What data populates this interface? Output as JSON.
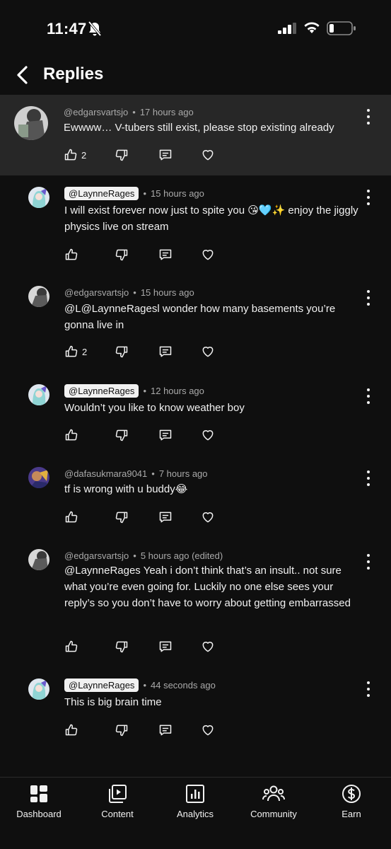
{
  "status": {
    "time": "11:47"
  },
  "header": {
    "title": "Replies"
  },
  "main_comment": {
    "handle": "@edgarsvartsjo",
    "time": "17 hours ago",
    "text": "Ewwww… V-tubers still exist, please stop existing already",
    "likes": "2"
  },
  "replies": [
    {
      "handle": "@LaynneRages",
      "time": "15 hours ago",
      "text": "I will exist forever now just to spite you 😘🩵✨ enjoy the jiggly physics live on stream",
      "likes": ""
    },
    {
      "handle": "@edgarsvartsjo",
      "time": "15 hours ago",
      "text": "@L@LaynneRagesl wonder how many basements you’re gonna live in",
      "likes": "2"
    },
    {
      "handle": "@LaynneRages",
      "time": "12 hours ago",
      "text": "Wouldn’t you like to know weather boy",
      "likes": ""
    },
    {
      "handle": "@dafasukmara9041",
      "time": "7 hours ago",
      "text": "tf is wrong with u buddy😂",
      "likes": ""
    },
    {
      "handle": "@edgarsvartsjo",
      "time": "5 hours ago (edited)",
      "text": "@LaynneRages Yeah i don’t think that’s an insult.. not sure what you’re even going for. Luckily no one else sees your reply’s so you don’t have to worry about getting embarrassed",
      "likes": ""
    },
    {
      "handle": "@LaynneRages",
      "time": "44 seconds ago",
      "text": "This is big brain time",
      "likes": ""
    }
  ],
  "separator": "•",
  "nav": [
    {
      "label": "Dashboard",
      "icon": "dashboard-icon"
    },
    {
      "label": "Content",
      "icon": "content-icon"
    },
    {
      "label": "Analytics",
      "icon": "analytics-icon"
    },
    {
      "label": "Community",
      "icon": "community-icon"
    },
    {
      "label": "Earn",
      "icon": "earn-icon"
    }
  ],
  "colors": {
    "background": "#0f0f0f",
    "highlight": "#272727",
    "text": "#f1f1f1",
    "meta": "#aaaaaa"
  }
}
